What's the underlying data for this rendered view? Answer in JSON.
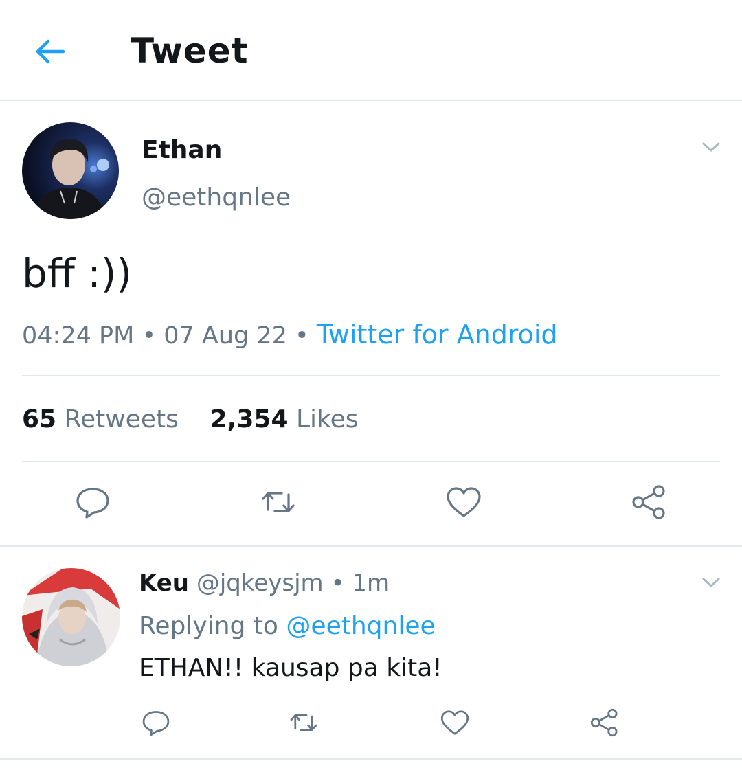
{
  "header": {
    "title": "Tweet",
    "back_icon": "arrow-left-icon",
    "accent": "#1da1f2"
  },
  "tweet": {
    "name": "Ethan",
    "handle": "@eethqnlee",
    "text": "bff :))",
    "time": "04:24 PM",
    "date": "07 Aug 22",
    "source": "Twitter for Android",
    "separator": "•",
    "retweets_count": "65",
    "retweets_label": "Retweets",
    "likes_count": "2,354",
    "likes_label": "Likes",
    "actions": [
      "reply-icon",
      "retweet-icon",
      "heart-icon",
      "share-icon"
    ]
  },
  "reply": {
    "name": "Keu",
    "handle": "@jqkeysjm",
    "separator": "•",
    "time": "1m",
    "replying_prefix": "Replying to",
    "replying_to": "@eethqnlee",
    "text": "ETHAN!! kausap pa kita!",
    "actions": [
      "reply-icon",
      "retweet-icon",
      "heart-icon",
      "share-icon"
    ]
  }
}
